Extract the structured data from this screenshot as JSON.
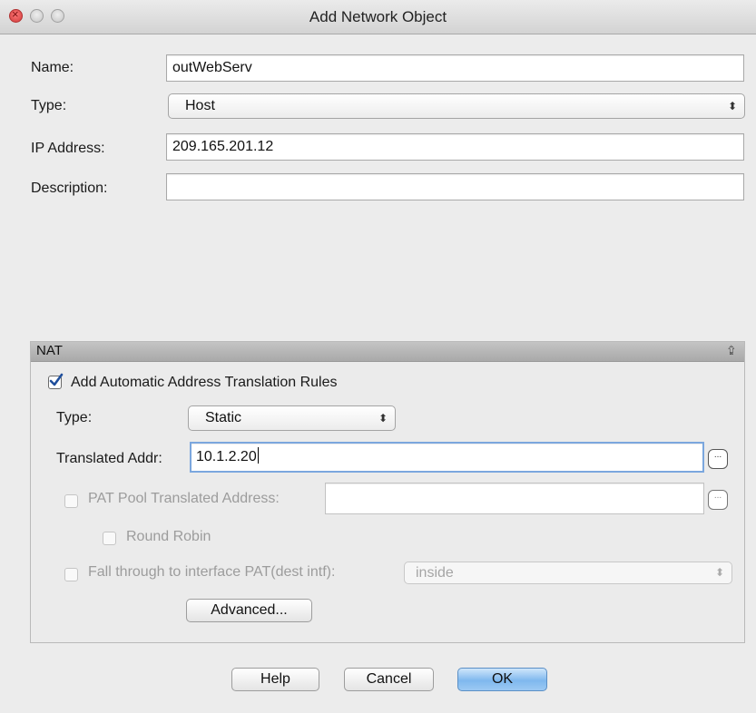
{
  "window": {
    "title": "Add Network Object"
  },
  "form": {
    "name_label": "Name:",
    "name_value": "outWebServ",
    "type_label": "Type:",
    "type_value": "Host",
    "ip_label": "IP Address:",
    "ip_value": "209.165.201.12",
    "description_label": "Description:",
    "description_value": ""
  },
  "nat": {
    "header": "NAT",
    "auto_rules_label": "Add Automatic Address Translation Rules",
    "auto_rules_checked": true,
    "type_label": "Type:",
    "type_value": "Static",
    "translated_label": "Translated Addr:",
    "translated_value": "10.1.2.20",
    "pat_pool_label": "PAT Pool Translated Address:",
    "pat_pool_value": "",
    "pat_pool_checked": false,
    "round_robin_label": "Round Robin",
    "round_robin_checked": false,
    "fall_through_label": "Fall through to interface PAT(dest intf):",
    "fall_through_checked": false,
    "fall_through_value": "inside",
    "advanced_label": "Advanced...",
    "ellipsis_label": "..."
  },
  "buttons": {
    "help": "Help",
    "cancel": "Cancel",
    "ok": "OK"
  },
  "icons": {
    "close": "close-icon",
    "minimize": "minimize-icon",
    "zoom": "zoom-icon",
    "collapse": "collapse-chevron-icon",
    "dropdown": "up-down-arrows-icon",
    "check": "checkmark-icon"
  },
  "colors": {
    "primary_button": "#7fb8ee",
    "focus_ring": "#7ba7de",
    "checkmark": "#1f4f9c"
  }
}
